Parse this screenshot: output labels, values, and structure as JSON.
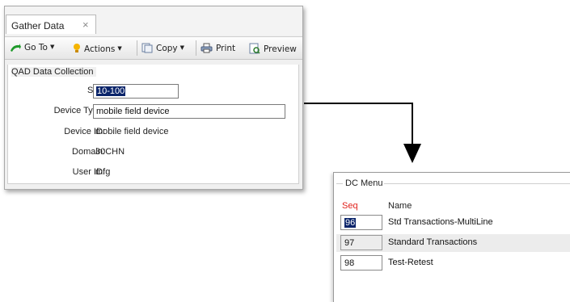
{
  "window": {
    "tab_title": "Gather Data",
    "tab_close_glyph": "×"
  },
  "toolbar": {
    "goto_label": "Go To",
    "actions_label": "Actions",
    "copy_label": "Copy",
    "print_label": "Print",
    "preview_label": "Preview",
    "caret": "▼"
  },
  "form": {
    "section_title": "QAD Data Collection",
    "site_label": "Site:",
    "site_value": "10-100",
    "device_type_label": "Device Type:",
    "device_type_value": "mobile field device",
    "device_id_label": "Device ID:",
    "device_id_value": "mobile field device",
    "domain_label": "Domain:",
    "domain_value": "30CHN",
    "user_id_label": "User ID:",
    "user_id_value": "mfg"
  },
  "dc_menu": {
    "title": "DC Menu",
    "col_seq": "Seq",
    "col_name": "Name",
    "rows": [
      {
        "seq": "96",
        "name": "Std Transactions-MultiLine"
      },
      {
        "seq": "97",
        "name": "Standard Transactions"
      },
      {
        "seq": "98",
        "name": "Test-Retest"
      }
    ]
  },
  "colors": {
    "seq_header": "#e0201a",
    "selection": "#0a246a",
    "connector": "#000000"
  },
  "icons": [
    "go-to-icon",
    "actions-lightbulb-icon",
    "copy-icon",
    "print-icon",
    "preview-icon",
    "tab-close-icon",
    "dropdown-caret-icon"
  ]
}
